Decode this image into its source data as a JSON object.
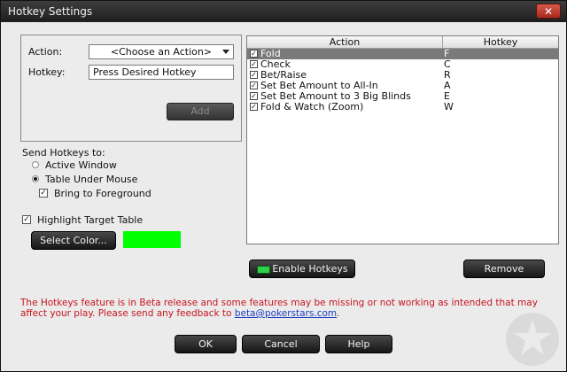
{
  "window": {
    "title": "Hotkey Settings",
    "close_glyph": "✕"
  },
  "action_panel": {
    "action_label": "Action:",
    "action_selected": "<Choose an Action>",
    "hotkey_label": "Hotkey:",
    "hotkey_value": "Press Desired Hotkey",
    "add_label": "Add"
  },
  "send_to": {
    "label": "Send Hotkeys to:",
    "options": [
      {
        "label": "Active Window",
        "selected": false
      },
      {
        "label": "Table Under Mouse",
        "selected": true
      }
    ],
    "bring_to_foreground_label": "Bring to Foreground",
    "bring_to_foreground_checked": true
  },
  "highlight": {
    "label": "Highlight Target Table",
    "checked": true,
    "select_color_label": "Select Color...",
    "color": "#00ff00"
  },
  "table": {
    "columns": [
      "Action",
      "Hotkey"
    ],
    "rows": [
      {
        "action": "Fold",
        "hotkey": "F",
        "checked": true,
        "selected": true
      },
      {
        "action": "Check",
        "hotkey": "C",
        "checked": true,
        "selected": false
      },
      {
        "action": "Bet/Raise",
        "hotkey": "R",
        "checked": true,
        "selected": false
      },
      {
        "action": "Set Bet Amount to All-In",
        "hotkey": "A",
        "checked": true,
        "selected": false
      },
      {
        "action": "Set Bet Amount to 3 Big Blinds",
        "hotkey": "E",
        "checked": true,
        "selected": false
      },
      {
        "action": "Fold & Watch (Zoom)",
        "hotkey": "W",
        "checked": true,
        "selected": false
      }
    ]
  },
  "buttons": {
    "enable_hotkeys": "Enable Hotkeys",
    "remove": "Remove",
    "ok": "OK",
    "cancel": "Cancel",
    "help": "Help"
  },
  "notice": {
    "text": "The Hotkeys feature is in Beta release and some features may be missing or not working as intended that may affect your play. Please send any feedback to ",
    "email": "beta@pokerstars.com",
    "suffix": "."
  },
  "colors": {
    "selected_row": "#7a7a7a",
    "notice": "#c8141e",
    "link": "#1a3fbf",
    "enable_led": "#2fd14a"
  },
  "icons": {
    "check_glyph": "✓",
    "watermark": "spade-star-icon"
  }
}
